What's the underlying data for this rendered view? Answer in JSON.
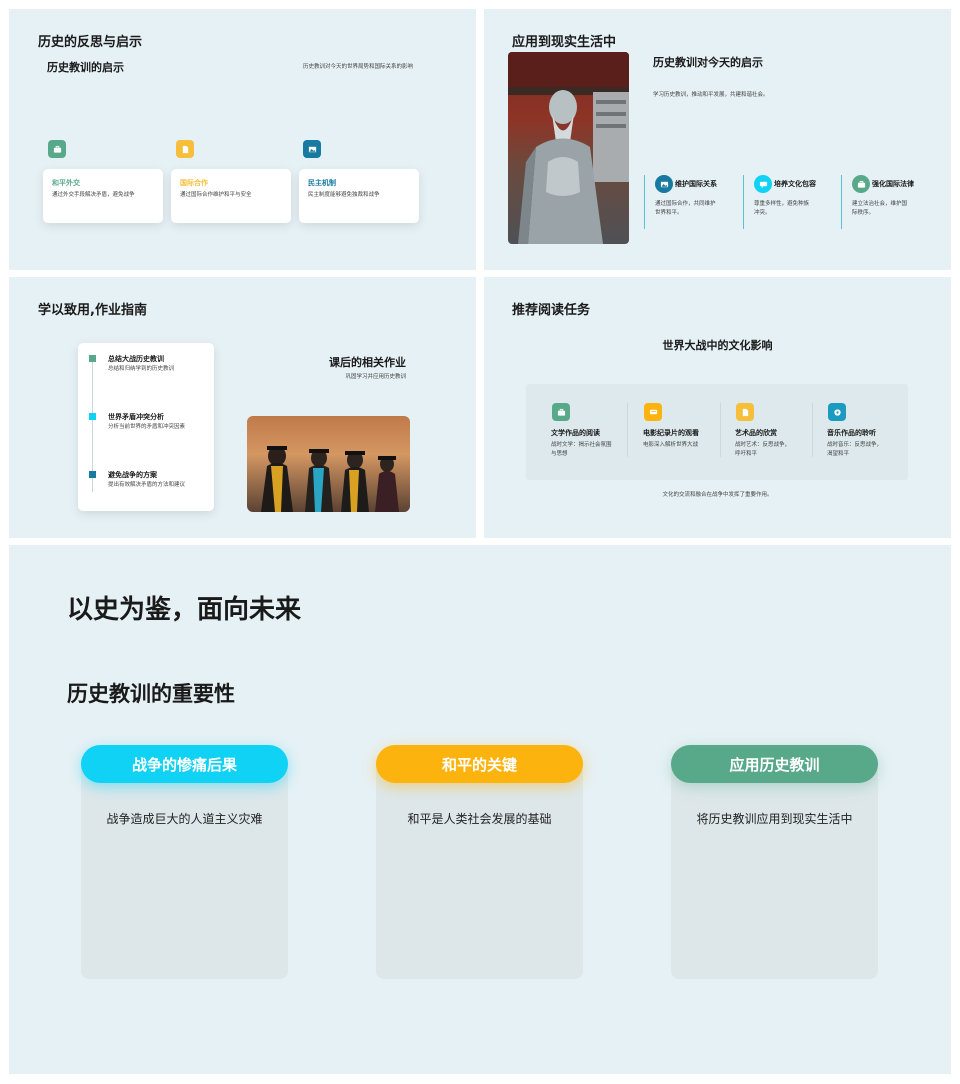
{
  "colors": {
    "green": "#58a98a",
    "yellow": "#f6be39",
    "teal": "#1879a1",
    "cyan": "#10d2f5",
    "orange": "#fdb30d",
    "bg": "#e6f1f5"
  },
  "s1": {
    "title": "历史的反思与启示",
    "subtitle": "历史教训的启示",
    "desc": "历史教训对今天的世界局势和国际关系的影响",
    "cards": [
      {
        "title": "和平外交",
        "text": "通过外交手段解决矛盾，避免战争",
        "icon": "briefcase-icon"
      },
      {
        "title": "国际合作",
        "text": "通过国际合作维护和平与安全",
        "icon": "document-icon"
      },
      {
        "title": "民主机制",
        "text": "民主制度能够避免独裁和战争",
        "icon": "image-icon"
      }
    ]
  },
  "s2": {
    "title": "应用到现实生活中",
    "subtitle": "历史教训对今天的启示",
    "desc": "学习历史教训，推动和平发展，共建和谐社会。",
    "photo": "confucius-statue-photo",
    "items": [
      {
        "title": "维护国际关系",
        "text": "通过国际合作，共同维护世界和平。",
        "icon": "image-icon"
      },
      {
        "title": "培养文化包容",
        "text": "尊重多样性，避免种族冲突。",
        "icon": "chat-icon"
      },
      {
        "title": "强化国际法律",
        "text": "建立法治社会，维护国际秩序。",
        "icon": "briefcase-icon"
      }
    ]
  },
  "s3": {
    "title": "学以致用,作业指南",
    "subtitle": "课后的相关作业",
    "desc": "巩固学习并应用历史教训",
    "photo": "graduates-photo",
    "steps": [
      {
        "title": "总结大战历史教训",
        "text": "总结和归纳学到的历史教训"
      },
      {
        "title": "世界矛盾冲突分析",
        "text": "分析当前世界的矛盾和冲突因素"
      },
      {
        "title": "避免战争的方案",
        "text": "提出有效解决矛盾的方法和建议"
      }
    ]
  },
  "s4": {
    "title": "推荐阅读任务",
    "subtitle": "世界大战中的文化影响",
    "footer": "文化的交流和融合在战争中发挥了重要作用。",
    "items": [
      {
        "title": "文学作品的阅读",
        "text": "战时文学：揭示社会氛围与思想",
        "icon": "briefcase-icon"
      },
      {
        "title": "电影纪录片的观看",
        "text": "电影深入解析世界大战",
        "icon": "chat-icon"
      },
      {
        "title": "艺术品的欣赏",
        "text": "战时艺术：反思战争，呼吁和平",
        "icon": "document-icon"
      },
      {
        "title": "音乐作品的聆听",
        "text": "战时音乐：反思战争，渴望和平",
        "icon": "location-icon"
      }
    ]
  },
  "s5": {
    "title": "以史为鉴，面向未来",
    "subtitle": "历史教训的重要性",
    "columns": [
      {
        "label": "战争的惨痛后果",
        "text": "战争造成巨大的人道主义灾难"
      },
      {
        "label": "和平的关键",
        "text": "和平是人类社会发展的基础"
      },
      {
        "label": "应用历史教训",
        "text": "将历史教训应用到现实生活中"
      }
    ]
  }
}
